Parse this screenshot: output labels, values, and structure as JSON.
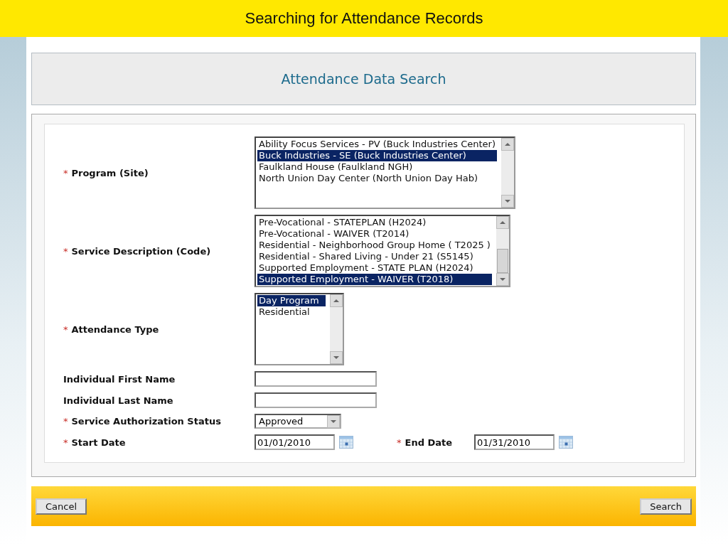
{
  "slide_title": "Searching for Attendance Records",
  "form_title": "Attendance Data Search",
  "fields": [
    {
      "kind": "listbox",
      "label": "Program (Site)",
      "marker": "*",
      "options": [
        {
          "text": "Ability Focus Services - PV (Buck Industries Center)",
          "selected": false
        },
        {
          "text": "Buck Industries - SE (Buck Industries Center)",
          "selected": true
        },
        {
          "text": "Faulkland House (Faulkland NGH)",
          "selected": false
        },
        {
          "text": "North Union Day Center (North Union Day Hab)",
          "selected": false
        }
      ]
    },
    {
      "kind": "listbox",
      "label": "Service Description (Code)",
      "marker": "*",
      "options": [
        {
          "text": "Pre-Vocational - STATEPLAN (H2024)",
          "selected": false
        },
        {
          "text": "Pre-Vocational - WAIVER (T2014)",
          "selected": false
        },
        {
          "text": "Residential - Neighborhood Group Home ( T2025 )",
          "selected": false
        },
        {
          "text": "Residential - Shared Living - Under 21 (S5145)",
          "selected": false
        },
        {
          "text": "Supported Employment - STATE PLAN (H2024)",
          "selected": false
        },
        {
          "text": "Supported Employment - WAIVER (T2018)",
          "selected": true
        }
      ]
    },
    {
      "kind": "listbox",
      "label": "Attendance Type",
      "marker": "*",
      "options": [
        {
          "text": "Day Program",
          "selected": true
        },
        {
          "text": "Residential",
          "selected": false
        }
      ]
    },
    {
      "kind": "text",
      "label": "Individual First Name"
    },
    {
      "kind": "text",
      "label": "Individual Last Name"
    },
    {
      "kind": "select",
      "label": "Service Authorization Status",
      "marker": "*",
      "value": "Approved"
    },
    {
      "kind": "dates",
      "label": "Start Date",
      "marker": "*",
      "value": "01/01/2010",
      "end_label": "End Date",
      "end_marker": "*",
      "end_value": "01/31/2010"
    }
  ],
  "buttons": {
    "cancel": "Cancel",
    "search": "Search"
  }
}
